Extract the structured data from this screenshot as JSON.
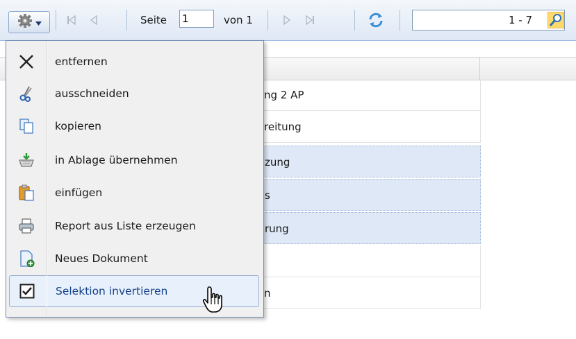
{
  "toolbar": {
    "page_label": "Seite",
    "page_value": "1",
    "of_label": "von 1",
    "range_label": "1 - 7"
  },
  "menu": {
    "items": [
      {
        "label": "entfernen",
        "icon": "close-x-icon"
      },
      {
        "label": "ausschneiden",
        "icon": "scissors-icon"
      },
      {
        "label": "kopieren",
        "icon": "copy-icon"
      },
      {
        "label": "in Ablage übernehmen",
        "icon": "basket-add-icon"
      },
      {
        "label": "einfügen",
        "icon": "paste-icon"
      },
      {
        "label": "Report aus Liste erzeugen",
        "icon": "printer-icon"
      },
      {
        "label": "Neues Dokument",
        "icon": "new-document-icon"
      },
      {
        "label": "Selektion invertieren",
        "icon": "checkbox-checked-icon"
      }
    ]
  },
  "grid": {
    "rows": [
      {
        "text": "ng 2 AP",
        "selected": false
      },
      {
        "text": "reitung",
        "selected": false
      },
      {
        "text": "zung",
        "selected": true
      },
      {
        "text": "s",
        "selected": true
      },
      {
        "text": "rung",
        "selected": true
      },
      {
        "text": "",
        "selected": false
      },
      {
        "text": "n",
        "selected": false
      }
    ]
  }
}
